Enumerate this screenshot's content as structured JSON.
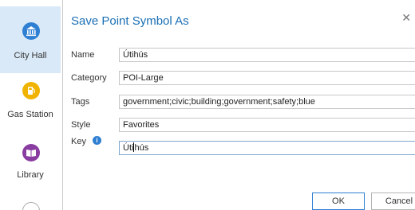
{
  "gallery": {
    "items": [
      {
        "label": "City Hall",
        "icon": "city-hall-icon",
        "color": "#2f7fd3",
        "selected": true
      },
      {
        "label": "Gas Station",
        "icon": "gas-pump-icon",
        "color": "#f0b400",
        "selected": false
      },
      {
        "label": "Library",
        "icon": "book-icon",
        "color": "#8a3da1",
        "selected": false
      }
    ]
  },
  "dialog": {
    "title": "Save Point Symbol As",
    "fields": {
      "name": {
        "label": "Name",
        "value": "Útihús"
      },
      "category": {
        "label": "Category",
        "value": "POI-Large"
      },
      "tags": {
        "label": "Tags",
        "value": "government;civic;building;government;safety;blue"
      },
      "style": {
        "label": "Style",
        "value": "Favorites"
      },
      "key": {
        "label": "Key",
        "value_before_caret": "Úti",
        "value_after_caret": "hús"
      }
    },
    "buttons": {
      "ok": "OK",
      "cancel": "Cancel"
    }
  }
}
